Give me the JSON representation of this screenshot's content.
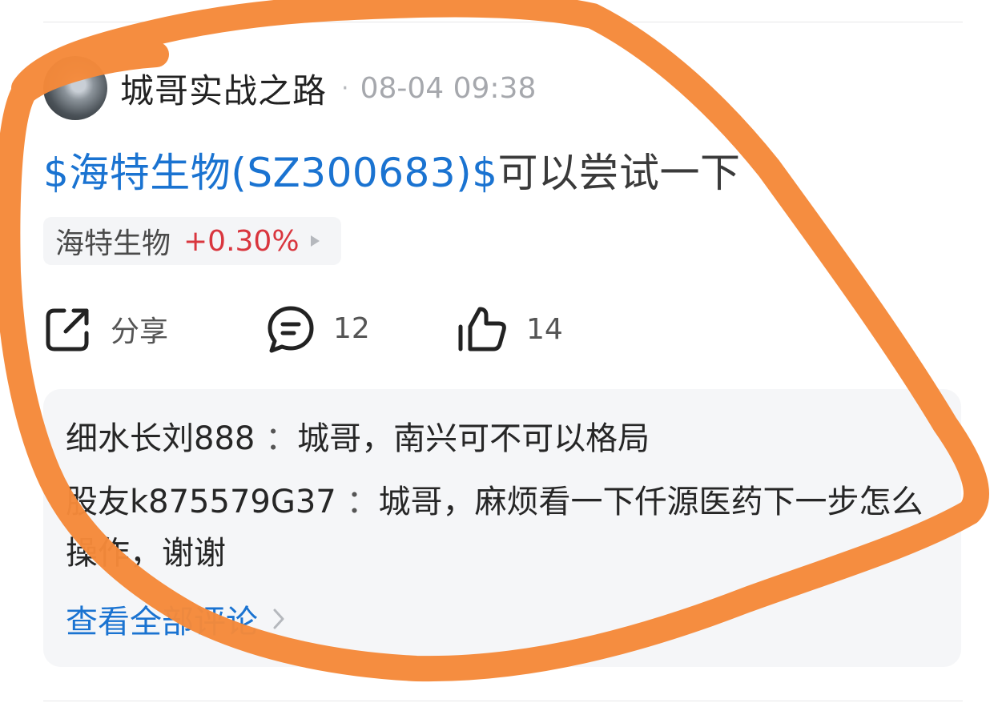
{
  "post": {
    "author": "城哥实战之路",
    "separator": "·",
    "time": "08-04 09:38",
    "stock_link": "$海特生物(SZ300683)$",
    "text": "可以尝试一下"
  },
  "stock_chip": {
    "name": "海特生物",
    "change": "+0.30%",
    "change_color": "#d9363e"
  },
  "actions": {
    "share_label": "分享",
    "comment_count": "12",
    "like_count": "14"
  },
  "comments": [
    {
      "user": "细水长刘888",
      "sep": " ：",
      "text": "城哥，南兴可不可以格局"
    },
    {
      "user": "股友k875579G37",
      "sep": " ：",
      "text": "城哥，麻烦看一下仟源医药下一步怎么操作，谢谢"
    }
  ],
  "view_all_label": "查看全部评论",
  "colors": {
    "link": "#1a73d1",
    "annotation": "#f5893a"
  },
  "icons": [
    "share-icon",
    "comment-icon",
    "thumbs-up-icon",
    "chevron-right-icon"
  ]
}
